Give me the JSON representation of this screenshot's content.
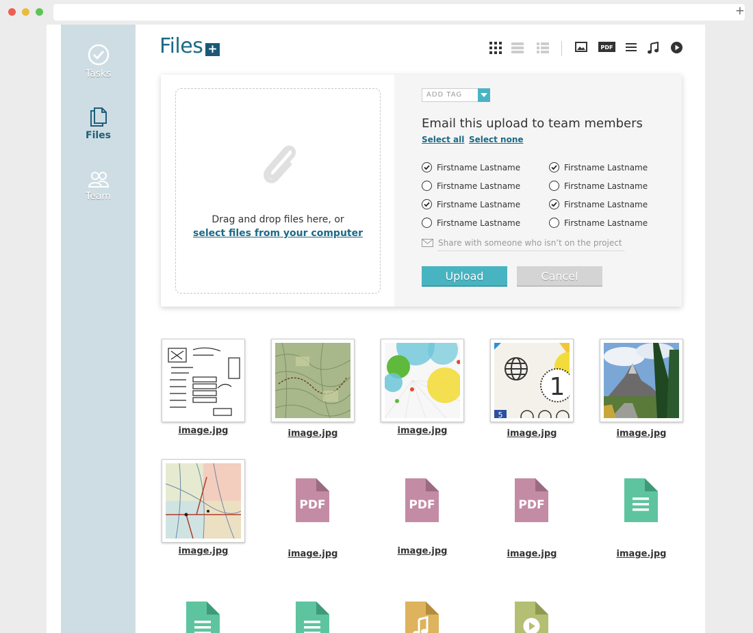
{
  "sidebar": {
    "items": [
      {
        "label": "Tasks",
        "icon": "check-circle-icon"
      },
      {
        "label": "Files",
        "icon": "files-icon"
      },
      {
        "label": "Team",
        "icon": "team-icon"
      }
    ]
  },
  "header": {
    "title": "Files",
    "add_label": "+"
  },
  "upload": {
    "drop_text": "Drag and drop files here, or",
    "drop_link": "select files from your computer",
    "tag_placeholder": "ADD TAG",
    "email_heading": "Email this upload to team members",
    "select_all": "Select all",
    "select_none": "Select none",
    "members": [
      {
        "name": "Firstname Lastname",
        "checked": true
      },
      {
        "name": "Firstname Lastname",
        "checked": true
      },
      {
        "name": "Firstname Lastname",
        "checked": false
      },
      {
        "name": "Firstname Lastname",
        "checked": false
      },
      {
        "name": "Firstname Lastname",
        "checked": true
      },
      {
        "name": "Firstname Lastname",
        "checked": true
      },
      {
        "name": "Firstname Lastname",
        "checked": false
      },
      {
        "name": "Firstname Lastname",
        "checked": false
      }
    ],
    "share_placeholder": "Share with someone who isn’t on the project",
    "upload_label": "Upload",
    "cancel_label": "Cancel"
  },
  "toolbar": {
    "pdf_label": "PDF"
  },
  "files": [
    {
      "name": "image.jpg",
      "kind": "sketch"
    },
    {
      "name": "image.jpg",
      "kind": "topo-map"
    },
    {
      "name": "image.jpg",
      "kind": "bubbles"
    },
    {
      "name": "image.jpg",
      "kind": "globe-numbers"
    },
    {
      "name": "image.jpg",
      "kind": "landscape"
    },
    {
      "name": "image.jpg",
      "kind": "road-map"
    },
    {
      "name": "image.jpg",
      "kind": "pdf",
      "badge": "PDF"
    },
    {
      "name": "image.jpg",
      "kind": "pdf",
      "badge": "PDF"
    },
    {
      "name": "image.jpg",
      "kind": "pdf",
      "badge": "PDF"
    },
    {
      "name": "image.jpg",
      "kind": "document"
    },
    {
      "name": "",
      "kind": "document"
    },
    {
      "name": "",
      "kind": "document"
    },
    {
      "name": "",
      "kind": "audio"
    },
    {
      "name": "",
      "kind": "video"
    }
  ],
  "colors": {
    "accent": "#49b4c1",
    "title": "#1a6a85",
    "sidebar": "#cedde3",
    "pdf": "#c48ba5",
    "doc": "#5ec4a0",
    "audio": "#ddb35e",
    "video": "#b5bf74"
  }
}
